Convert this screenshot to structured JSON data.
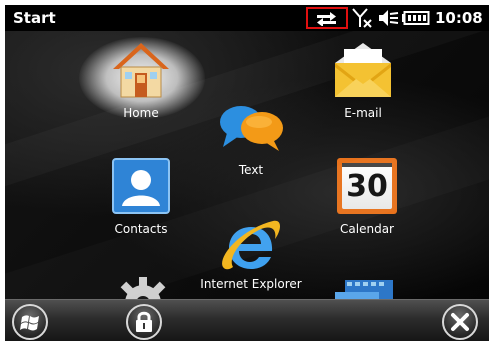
{
  "status_bar": {
    "title": "Start",
    "time": "10:08"
  },
  "tiles": {
    "home": "Home",
    "email": "E-mail",
    "text": "Text",
    "contacts": "Contacts",
    "calendar": "Calendar",
    "calendar_day": "30",
    "internet_explorer": "Internet Explorer"
  },
  "colors": {
    "highlight_box": "#e01010",
    "contacts_blue": "#2f84d6",
    "email_yellow": "#f4c232",
    "calendar_orange": "#e8721c"
  },
  "icons": [
    "connectivity-icon",
    "signal-icon",
    "volume-mute-icon",
    "battery-icon",
    "windows-start-icon",
    "lock-icon",
    "close-icon",
    "settings-icon",
    "media-icon"
  ]
}
